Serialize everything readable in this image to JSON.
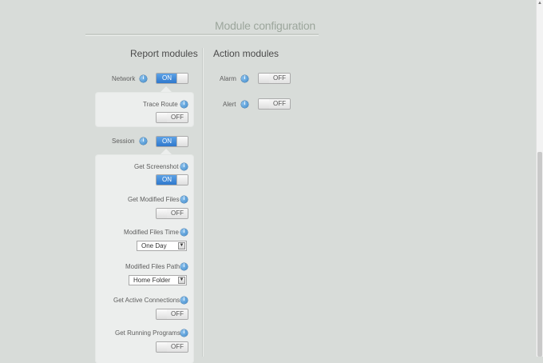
{
  "page": {
    "title": "Module configuration"
  },
  "columns": {
    "report": "Report modules",
    "action": "Action modules"
  },
  "report": {
    "network": {
      "label": "Network",
      "state": "ON"
    },
    "trace_route": {
      "label": "Trace Route",
      "state": "OFF"
    },
    "session": {
      "label": "Session",
      "state": "ON"
    },
    "get_screenshot": {
      "label": "Get Screenshot",
      "state": "ON"
    },
    "get_modified_files": {
      "label": "Get Modified Files",
      "state": "OFF"
    },
    "modified_files_time": {
      "label": "Modified Files Time",
      "value": "One Day"
    },
    "modified_files_path": {
      "label": "Modified Files Path",
      "value": "Home Folder"
    },
    "get_active_connections": {
      "label": "Get Active Connections",
      "state": "OFF"
    },
    "get_running_programs": {
      "label": "Get Running Programs",
      "state": "OFF"
    }
  },
  "action": {
    "alarm": {
      "label": "Alarm",
      "state": "OFF"
    },
    "alert": {
      "label": "Alert",
      "state": "OFF"
    }
  },
  "icons": {
    "info": "info-icon",
    "dropdown": "chevron-down-icon"
  },
  "colors": {
    "background": "#d8dcd9",
    "toggle_on": "#2f78cc",
    "info": "#3a86c8"
  }
}
